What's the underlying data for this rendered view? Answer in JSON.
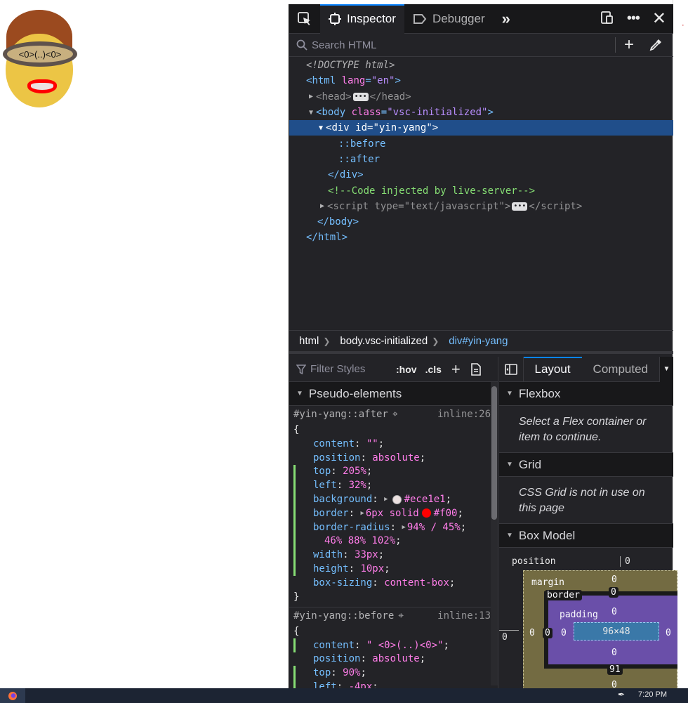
{
  "page": {
    "goggles_text": "<0>(..)<0>"
  },
  "toolbar": {
    "tabs": [
      {
        "label": "Inspector"
      },
      {
        "label": "Debugger"
      }
    ]
  },
  "search": {
    "placeholder": "Search HTML"
  },
  "markup": {
    "doctype": "<!DOCTYPE html>",
    "html_tag": "html",
    "html_attr": "lang",
    "html_val": "\"en\"",
    "head_tag": "head",
    "body_tag": "body",
    "body_attr": "class",
    "body_val": "\"vsc-initialized\"",
    "div_tag": "div",
    "div_attr": "id",
    "div_val": "\"yin-yang\"",
    "before": "::before",
    "after": "::after",
    "comment": "<!--Code injected by live-server-->",
    "script_tag": "script",
    "script_attr": "type",
    "script_val": "\"text/javascript\""
  },
  "breadcrumbs": [
    "html",
    "body.vsc-initialized",
    "div#yin-yang"
  ],
  "rules": {
    "filter_placeholder": "Filter Styles",
    "hov": ":hov",
    "cls": ".cls",
    "section": "Pseudo-elements",
    "after_selector": "#yin-yang::after",
    "after_source": "inline:26",
    "after_decls": [
      {
        "name": "content",
        "value": "\"\"",
        "changed": false
      },
      {
        "name": "position",
        "value": "absolute",
        "changed": false
      },
      {
        "name": "top",
        "value": "205%",
        "changed": true
      },
      {
        "name": "left",
        "value": "32%",
        "changed": true
      },
      {
        "name": "background",
        "value": "#ece1e1",
        "changed": true,
        "swatch": "#ece1e1",
        "expander": true
      },
      {
        "name": "border",
        "value": "6px solid",
        "changed": true,
        "swatch": "#f00",
        "value2": "#f00",
        "expander": true
      },
      {
        "name": "border-radius",
        "value": "94% / 45%",
        "changed": true,
        "expander": true
      },
      {
        "name": "",
        "value": "46% 88% 102%",
        "changed": true,
        "continuation": true
      },
      {
        "name": "width",
        "value": "33px",
        "changed": true
      },
      {
        "name": "height",
        "value": "10px",
        "changed": true
      },
      {
        "name": "box-sizing",
        "value": "content-box",
        "changed": false
      }
    ],
    "before_selector": "#yin-yang::before",
    "before_source": "inline:13",
    "before_decls": [
      {
        "name": "content",
        "value": "\" <0>(..)<0>\"",
        "changed": true
      },
      {
        "name": "position",
        "value": "absolute",
        "changed": false
      },
      {
        "name": "top",
        "value": "90%",
        "changed": true
      },
      {
        "name": "left",
        "value": "-4px",
        "changed": true
      }
    ]
  },
  "layout": {
    "tabs": [
      "Layout",
      "Computed"
    ],
    "flexbox_title": "Flexbox",
    "flexbox_msg": "Select a Flex container or item to continue.",
    "grid_title": "Grid",
    "grid_msg": "CSS Grid is not in use on this page",
    "boxmodel_title": "Box Model",
    "box": {
      "position_label": "position",
      "position_top": "0",
      "position_left": "0",
      "margin_label": "margin",
      "margin_top": "0",
      "margin_left": "0",
      "margin_bottom": "0",
      "border_label": "border",
      "border_top": "0",
      "border_left": "0",
      "border_bottom": "91",
      "padding_label": "padding",
      "padding_top": "0",
      "padding_left": "0",
      "padding_bottom": "0",
      "content": "96×48",
      "right_value": "0"
    }
  },
  "taskbar": {
    "time": "7:20 PM"
  }
}
